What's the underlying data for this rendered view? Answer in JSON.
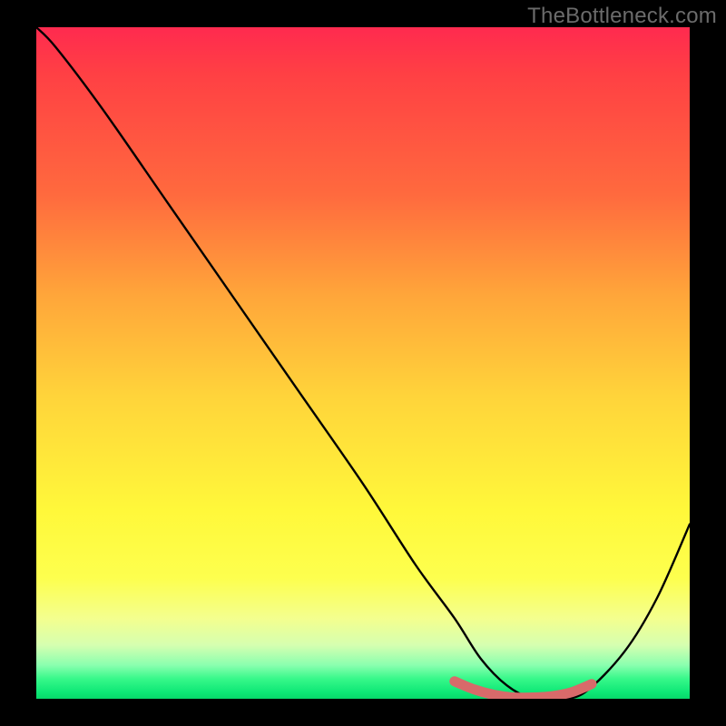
{
  "watermark": "TheBottleneck.com",
  "chart_data": {
    "type": "line",
    "title": "",
    "xlabel": "",
    "ylabel": "",
    "xlim": [
      0,
      100
    ],
    "ylim": [
      0,
      100
    ],
    "grid": false,
    "series": [
      {
        "name": "curve",
        "color": "#000000",
        "x": [
          0,
          3,
          10,
          20,
          30,
          40,
          50,
          58,
          64,
          68,
          72,
          76,
          80,
          84,
          90,
          95,
          100
        ],
        "y": [
          100,
          97,
          88,
          74,
          60,
          46,
          32,
          20,
          12,
          6,
          2,
          0,
          0,
          1,
          7,
          15,
          26
        ]
      }
    ],
    "highlight": {
      "name": "flat-min",
      "color": "#e06666",
      "x": [
        64,
        67,
        70,
        73,
        76,
        79,
        82,
        85
      ],
      "y": [
        2.6,
        1.4,
        0.6,
        0.2,
        0.2,
        0.4,
        1.0,
        2.2
      ]
    },
    "background_gradient": {
      "top": "#ff2a4f",
      "mid": "#fff83a",
      "bottom": "#07d86a"
    }
  }
}
